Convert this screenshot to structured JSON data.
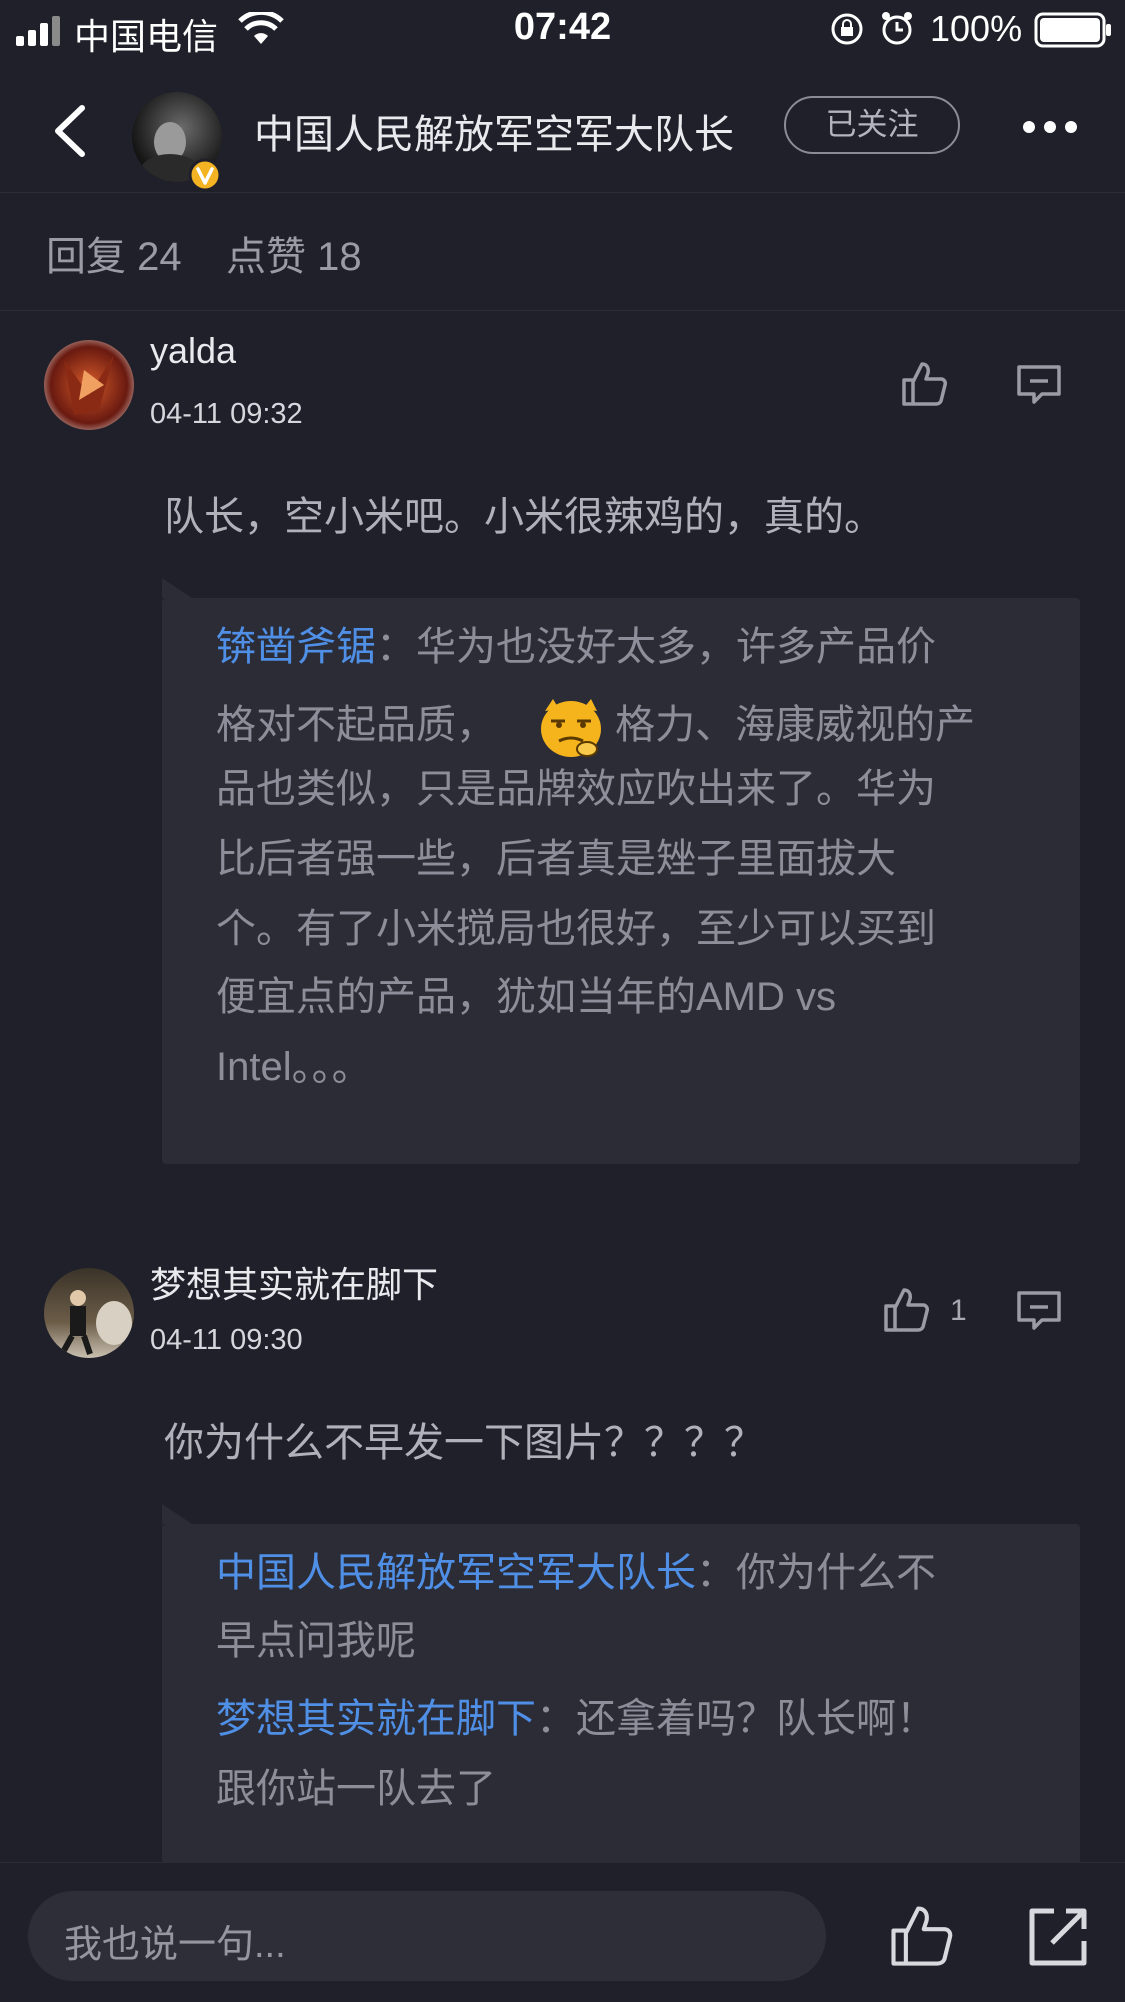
{
  "status_bar": {
    "carrier": "中国电信",
    "time": "07:42",
    "battery": "100%"
  },
  "header": {
    "title": "中国人民解放军空军大队长",
    "follow_label": "已关注"
  },
  "counts": {
    "replies": "回复 24",
    "likes": "点赞 18"
  },
  "comments": [
    {
      "user": "yalda",
      "time": "04-11 09:32",
      "text": "队长，空小米吧。小米很辣鸡的，真的。",
      "like_count": "",
      "reply": {
        "name": "锛凿斧锯",
        "line1": "：华为也没好太多，许多产品价",
        "line2a": "格对不起品质，",
        "line2b": "格力、海康威视的产",
        "line3": "品也类似，只是品牌效应吹出来了。华为",
        "line4": "比后者强一些，后者真是矬子里面拔大",
        "line5": "个。有了小米搅局也很好，至少可以买到",
        "line6": "便宜点的产品，犹如当年的AMD vs",
        "line7": "Intel。。。"
      }
    },
    {
      "user": "梦想其实就在脚下",
      "time": "04-11 09:30",
      "text": "你为什么不早发一下图片？？？？",
      "like_count": "1",
      "replies": [
        {
          "name": "中国人民解放军空军大队长",
          "line1": "：你为什么不",
          "line2": "早点问我呢"
        },
        {
          "name": "梦想其实就在脚下",
          "line1": "：还拿着吗？队长啊！",
          "line2": "跟你站一队去了"
        }
      ]
    }
  ],
  "bottom_bar": {
    "input_placeholder": "我也说一句..."
  },
  "icons": [
    "signal-icon",
    "wifi-icon",
    "rotation-lock-icon",
    "alarm-icon",
    "battery-icon",
    "back-icon",
    "verified-badge-icon",
    "more-icon",
    "thumbs-up-icon",
    "comment-icon",
    "share-icon",
    "emoji-sticker"
  ]
}
